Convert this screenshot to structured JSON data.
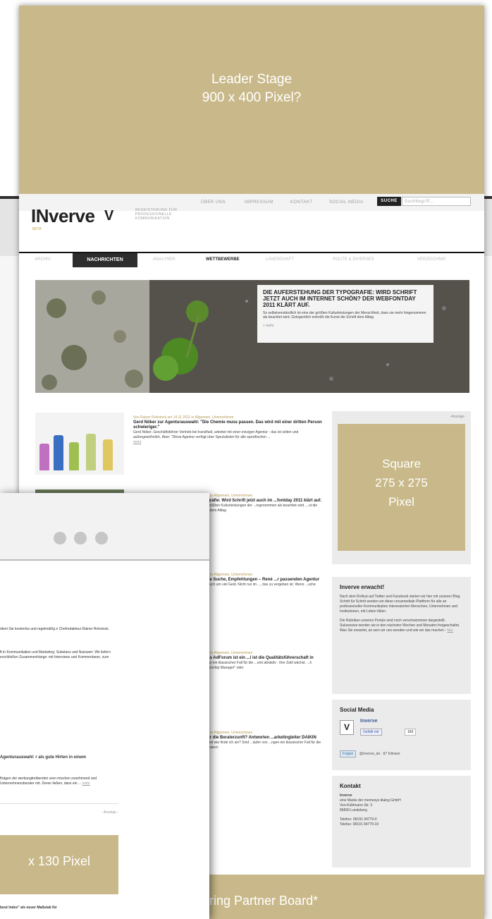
{
  "leader": {
    "line1": "Leader Stage",
    "line2": "900 x 400 Pixel?"
  },
  "topnav": {
    "items": [
      "ÜBER UNS",
      "IMPRESSUM",
      "KONTAKT",
      "SOCIAL MEDIA"
    ],
    "search_label": "SUCHE",
    "search_placeholder": "Suchbegriff..."
  },
  "logo": {
    "text": "INverve",
    "mark": "V",
    "tagline": "BEGEISTERUNG FÜR PROFESSIONELLE KOMMUNIKATION",
    "beta": "BETA"
  },
  "catnav": {
    "items": [
      "ARCHIV",
      "NACHRICHTEN",
      "ANALYSEN",
      "WETTBEWERBE",
      "LANDSCHAFT",
      "ROUTE & DIVERSES",
      "VERZEICHNIS"
    ],
    "active": "NACHRICHTEN"
  },
  "hero": {
    "title": "DIE AUFERSTEHUNG DER TYPOGRAFIE: WIRD SCHRIFT JETZT AUCH IM INTERNET SCHÖN? DER WEBFONTDAY 2011 KLÄRT AUF.",
    "teaser": "So selbstverständlich ist eine der größten Kulturleistungen der Menschheit, dass sie mehr hingenommen als beachtet wird. Gelegentlich entreißt die Kunst die Schrift dem Alltag",
    "more": "» mehr"
  },
  "articles": [
    {
      "meta": "Von Rainer Rohstock am 14.11.2011 in Allgemein, Unternehmen",
      "title": "Gerd Nöker zur Agenturauswahl: \"Die Chemie muss passen. Das wird mit einer dritten Person schwieriger.\"",
      "text": "Gerd Nöker, Geschäftsführer Vertrieb bei transfluid, arbeitet mit einer einzigen Agentur - das ist selten und außergewöhnlich. Aber: \"Diese Agentur verfügt über Spezialisten für alle spezifischen ...",
      "more": "mehr"
    },
    {
      "meta": "...2011 in Allgemein, Unternehmen",
      "title": "...pografie: Wird Schrift jetzt auch im ...fontday 2011 klärt auf.",
      "text": "...der größten Kulturleistungen der ...ingenommen als beachtet wird. ...st die Schrift dem Alltag",
      "more": "mehr"
    },
    {
      "meta": "...2011 in Allgemein, Unternehmen",
      "title": "...sche Suche, Empfehlungen – René ...r passenden Agentur",
      "text": "...em auch um viel Geld. Nicht nur im ..., das zu vergeben ist. Wenn ...uche gehen,",
      "more": "mehr"
    },
    {
      "meta": "...2011 in Allgemein, Unternehmen",
      "title": "...\"Das AdForum ist ein ...l ist die Qualitätsführerschaft in",
      "text": "...gentur ein klassischer Fall für die ...eint attraktiv - ihre Zahl wächst. ...h \"Relationship Manager\" oder",
      "more": "mehr"
    },
    {
      "meta": "...2011 in Allgemein, Unternehmen",
      "title": "...ll für die Beraterzunft? Antworten ...arketingleiter DAIKIN",
      "text": "...e? Und wie finde ich sie? Sind ...äufer von ...ngen ein klassischer Fall für die ...n Beratern",
      "more": "mehr"
    }
  ],
  "sidebar": {
    "ad_label": "-Anzeige-",
    "square": [
      "Square",
      "275 x 275",
      "Pixel"
    ],
    "erwacht": {
      "title": "Inverve erwacht!",
      "p1": "Nach dem Rollout auf Twitter und Facebook starten wir hier mit unseren Blog. Schritt für Schritt werden wir diese crossmediale Plattform für alle an professioneller Kommunikation interessierten Menschen, Unternehmen und Institutionen, mit Leben füllen.",
      "p2": "Die Rubriken unseres Portals sind noch verschwommen dargestellt. Sukzessive werden sie in den nächsten Wochen und Monaten freigeschaltet. Was Sie erwartet, an wen wir uns wenden und wie wir das machen -",
      "p2_link": "hier"
    },
    "social": {
      "title": "Social Media",
      "name": "Inverve",
      "like": "Gefällt mir",
      "like_count": "163",
      "follow": "Folgen",
      "follow_text": "@inverve_de · 87 follower"
    },
    "kontakt": {
      "title": "Kontakt",
      "name": "Inverve",
      "lines": [
        "eine Marke der memesys dialog GmbH",
        "Von-Kühlmann-Str. 3",
        "86899 Landsberg"
      ],
      "phone": "Telefon: 08191 94779-0",
      "fax": "Telefax: 08191 94779-19"
    }
  },
  "partner": "ring Partner Board*",
  "overlay": {
    "p1": "dient Sie kostenlos und regelmäßig n Chefredakteur Rainer Rohstock.",
    "p2": "ft in Kommunikation und Marketing: Substanz und Nutzwert. Wir liefern erschließen Zusammenhänge: mit Interviews und Kommentaren, zum",
    "title": "Agenturauswahl: r als gute Hirten in einem",
    "p3": "fträgen der werbungtreibenden uren mischen zunehmend und Unternehmensberater mit. Deren ließen, dass ein ...",
    "more": "mehr",
    "ad_label": "- Anzeige -",
    "ad_text": "x 130 Pixel",
    "bottom": "bout Index\" als neuer Maßstab für"
  }
}
